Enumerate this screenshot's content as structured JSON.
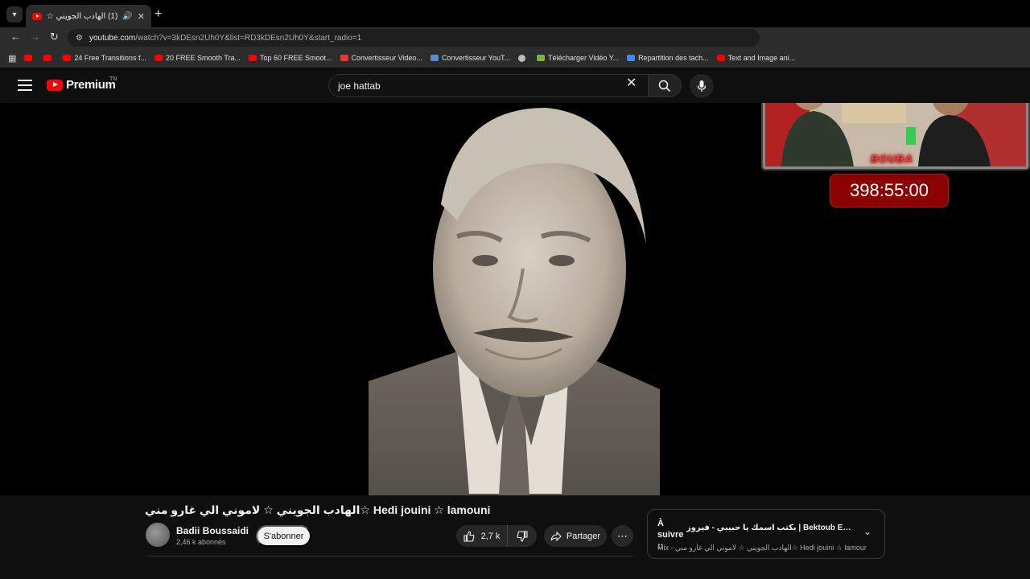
{
  "browser": {
    "tab": {
      "title": "(1) الهادب الجويني ☆ لاموني",
      "audio_icon": "speaker-icon"
    },
    "url": {
      "host": "youtube.com",
      "path": "/watch?v=3kDEsn2Uh0Y&list=RD3kDEsn2Uh0Y&start_radio=1"
    },
    "bookmarks": [
      {
        "label": "",
        "color": "#ff0000"
      },
      {
        "label": "",
        "color": "#ff0000"
      },
      {
        "label": "24 Free Transitions f...",
        "color": "#ff0000"
      },
      {
        "label": "20 FREE Smooth Tra...",
        "color": "#ff0000"
      },
      {
        "label": "Top 60 FREE Smoot...",
        "color": "#ff0000"
      },
      {
        "label": "Convertisseur Video...",
        "color": "#e53935"
      },
      {
        "label": "Convertisseur YouT...",
        "color": "#5c8ad4"
      },
      {
        "label": "",
        "color": "#bbbbbb"
      },
      {
        "label": "Télécharger Vidéo Y...",
        "color": "#7cb342"
      },
      {
        "label": "Repartition des tach...",
        "color": "#4285f4"
      },
      {
        "label": "Text and Image ani...",
        "color": "#ff0000"
      }
    ]
  },
  "youtube": {
    "logo_text": "Premium",
    "country": "TN",
    "search_value": "joe hattab",
    "video_title": "الهادب الجويني ☆ لاموني الي غارو مني☆ Hedi jouini ☆ lamouni",
    "channel": {
      "name": "Badii Boussaidi",
      "subscribers": "2,46 k abonnés"
    },
    "subscribe_label": "S'abonner",
    "like_count": "2,7 k",
    "share_label": "Partager",
    "up_next": {
      "label": "À suivre ::",
      "title": "بكتب اسمك يا حبيبي - فيروز | Bektoub Esmak Ya H...",
      "subtitle": "Mix - الهادب الجويني ☆ لاموني الي غارو مني☆ Hedi jouini ☆ lamouni"
    }
  },
  "overlay": {
    "webcam_label": "BOUBA",
    "timer": "398:55:00"
  }
}
